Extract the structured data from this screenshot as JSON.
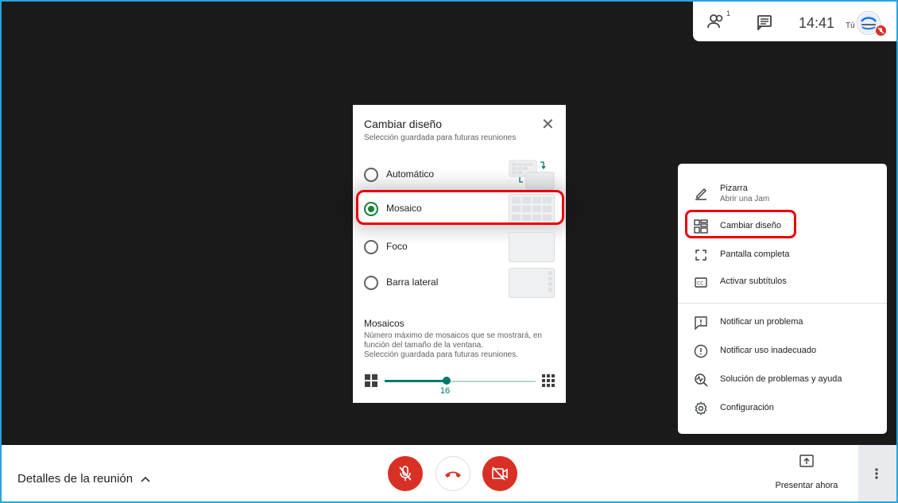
{
  "topbar": {
    "participants_count": "1",
    "clock": "14:41",
    "you_label": "Tú"
  },
  "dialog": {
    "title": "Cambiar diseño",
    "subtitle": "Selección guardada para futuras reuniones",
    "options": [
      {
        "label": "Automático",
        "selected": false
      },
      {
        "label": "Mosaico",
        "selected": true
      },
      {
        "label": "Foco",
        "selected": false
      },
      {
        "label": "Barra lateral",
        "selected": false
      }
    ],
    "tiles_title": "Mosaicos",
    "tiles_desc_1": "Número máximo de mosaicos que se mostrará, en",
    "tiles_desc_2": "función del tamaño de la ventana.",
    "tiles_desc_3": "Selección guardada para futuras reuniones.",
    "slider_value": "16",
    "slider_fraction": 0.41
  },
  "menu": {
    "items": [
      {
        "label": "Pizarra",
        "sub": "Abrir una Jam",
        "icon": "pen-icon"
      },
      {
        "label": "Cambiar diseño",
        "icon": "layout-icon"
      },
      {
        "label": "Pantalla completa",
        "icon": "fullscreen-icon"
      },
      {
        "label": "Activar subtítulos",
        "icon": "captions-icon"
      },
      {
        "label": "Notificar un problema",
        "icon": "report-problem-icon"
      },
      {
        "label": "Notificar uso inadecuado",
        "icon": "report-abuse-icon"
      },
      {
        "label": "Solución de problemas y ayuda",
        "icon": "troubleshoot-icon"
      },
      {
        "label": "Configuración",
        "icon": "settings-icon"
      }
    ]
  },
  "bottom": {
    "details_label": "Detalles de la reunión",
    "present_label": "Presentar ahora"
  },
  "colors": {
    "accent_red": "#d93025",
    "highlight_red": "#e8000b",
    "teal": "#00796b",
    "green_radio": "#188038",
    "frame_blue": "#29a3e0"
  }
}
